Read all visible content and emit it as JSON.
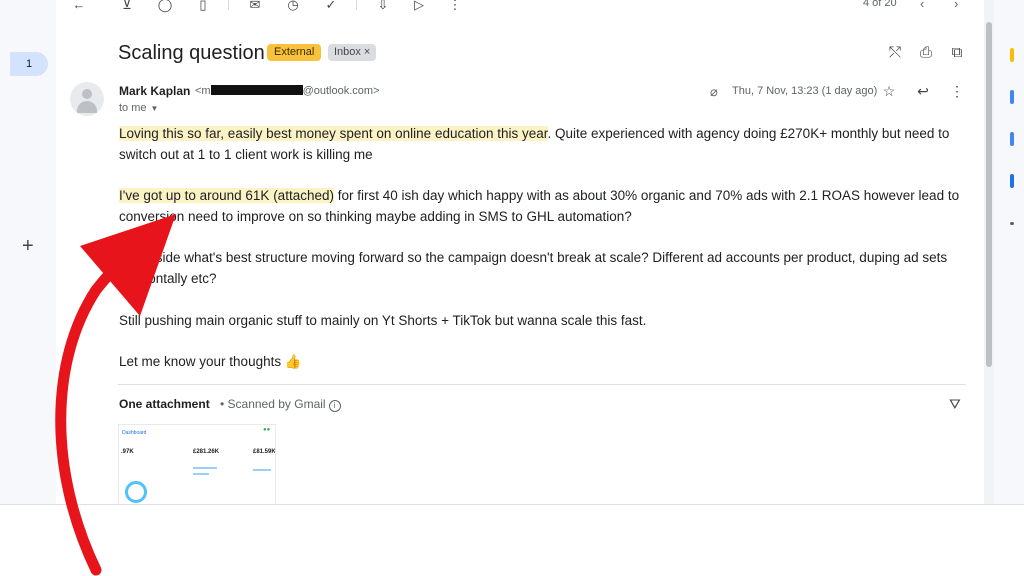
{
  "toolbar": {
    "icons": [
      "back-arrow-icon",
      "archive-icon",
      "report-spam-icon",
      "delete-icon",
      "mark-unread-icon",
      "snooze-icon",
      "add-task-icon",
      "move-to-icon",
      "label-icon",
      "more-vert-icon"
    ],
    "pager": "4 of 20"
  },
  "left_rail": {
    "badge": "1",
    "plus": "+"
  },
  "email": {
    "subject": "Scaling question",
    "labels": {
      "external": "External",
      "inbox": "Inbox",
      "inbox_remove": "×"
    },
    "sender_name": "Mark Kaplan",
    "sender_email_prefix": "<m",
    "sender_email_suffix": "@outlook.com>",
    "to": "to me",
    "date": "Thu, 7 Nov, 13:23 (1 day ago)",
    "body": {
      "p1_highlight": "Loving this so far, easily best money spent on online education this year",
      "p1_rest": ". Quite experienced with agency doing £270K+ monthly but need to switch out at 1 to 1 client work is killing me",
      "p2_highlight": "I've got up to around 61K (attached)",
      "p2_rest": " for first 40 ish day which happy with as about 30% organic and 70% ads with 2.1 ROAS however lead to conversion need to improve on so thinking maybe adding in SMS to GHL automation?",
      "p3": "Good side what's best structure moving forward so the campaign doesn't break at scale? Different ad accounts per product, duping ad sets horizontally etc?",
      "p4": "Still pushing main organic stuff to mainly on Yt Shorts + TikTok but wanna scale this fast.",
      "p5": "Let me know your thoughts 👍"
    },
    "attachment": {
      "title": "One attachment",
      "scanned": "• Scanned by Gmail",
      "info": "i",
      "thumb_title": "Dashboard",
      "thumb_values": [
        ".97K",
        "£281.26K",
        "£81.59K"
      ]
    }
  },
  "colors": {
    "highlight": "#fbf3c4",
    "external_label": "#f9c23c",
    "arrow": "#e8141b"
  }
}
